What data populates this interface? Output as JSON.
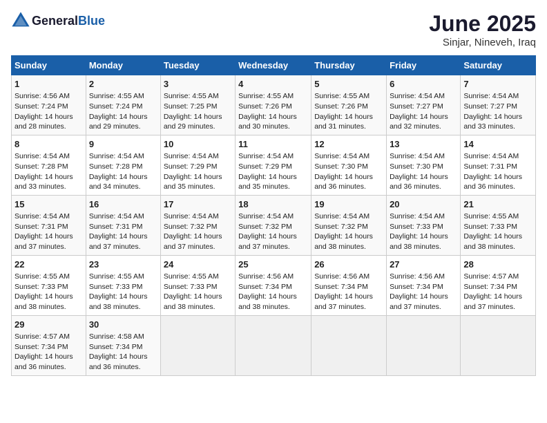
{
  "header": {
    "logo_general": "General",
    "logo_blue": "Blue",
    "title": "June 2025",
    "subtitle": "Sinjar, Nineveh, Iraq"
  },
  "calendar": {
    "weekdays": [
      "Sunday",
      "Monday",
      "Tuesday",
      "Wednesday",
      "Thursday",
      "Friday",
      "Saturday"
    ],
    "rows": [
      [
        {
          "day": "1",
          "lines": [
            "Sunrise: 4:56 AM",
            "Sunset: 7:24 PM",
            "Daylight: 14 hours",
            "and 28 minutes."
          ]
        },
        {
          "day": "2",
          "lines": [
            "Sunrise: 4:55 AM",
            "Sunset: 7:24 PM",
            "Daylight: 14 hours",
            "and 29 minutes."
          ]
        },
        {
          "day": "3",
          "lines": [
            "Sunrise: 4:55 AM",
            "Sunset: 7:25 PM",
            "Daylight: 14 hours",
            "and 29 minutes."
          ]
        },
        {
          "day": "4",
          "lines": [
            "Sunrise: 4:55 AM",
            "Sunset: 7:26 PM",
            "Daylight: 14 hours",
            "and 30 minutes."
          ]
        },
        {
          "day": "5",
          "lines": [
            "Sunrise: 4:55 AM",
            "Sunset: 7:26 PM",
            "Daylight: 14 hours",
            "and 31 minutes."
          ]
        },
        {
          "day": "6",
          "lines": [
            "Sunrise: 4:54 AM",
            "Sunset: 7:27 PM",
            "Daylight: 14 hours",
            "and 32 minutes."
          ]
        },
        {
          "day": "7",
          "lines": [
            "Sunrise: 4:54 AM",
            "Sunset: 7:27 PM",
            "Daylight: 14 hours",
            "and 33 minutes."
          ]
        }
      ],
      [
        {
          "day": "8",
          "lines": [
            "Sunrise: 4:54 AM",
            "Sunset: 7:28 PM",
            "Daylight: 14 hours",
            "and 33 minutes."
          ]
        },
        {
          "day": "9",
          "lines": [
            "Sunrise: 4:54 AM",
            "Sunset: 7:28 PM",
            "Daylight: 14 hours",
            "and 34 minutes."
          ]
        },
        {
          "day": "10",
          "lines": [
            "Sunrise: 4:54 AM",
            "Sunset: 7:29 PM",
            "Daylight: 14 hours",
            "and 35 minutes."
          ]
        },
        {
          "day": "11",
          "lines": [
            "Sunrise: 4:54 AM",
            "Sunset: 7:29 PM",
            "Daylight: 14 hours",
            "and 35 minutes."
          ]
        },
        {
          "day": "12",
          "lines": [
            "Sunrise: 4:54 AM",
            "Sunset: 7:30 PM",
            "Daylight: 14 hours",
            "and 36 minutes."
          ]
        },
        {
          "day": "13",
          "lines": [
            "Sunrise: 4:54 AM",
            "Sunset: 7:30 PM",
            "Daylight: 14 hours",
            "and 36 minutes."
          ]
        },
        {
          "day": "14",
          "lines": [
            "Sunrise: 4:54 AM",
            "Sunset: 7:31 PM",
            "Daylight: 14 hours",
            "and 36 minutes."
          ]
        }
      ],
      [
        {
          "day": "15",
          "lines": [
            "Sunrise: 4:54 AM",
            "Sunset: 7:31 PM",
            "Daylight: 14 hours",
            "and 37 minutes."
          ]
        },
        {
          "day": "16",
          "lines": [
            "Sunrise: 4:54 AM",
            "Sunset: 7:31 PM",
            "Daylight: 14 hours",
            "and 37 minutes."
          ]
        },
        {
          "day": "17",
          "lines": [
            "Sunrise: 4:54 AM",
            "Sunset: 7:32 PM",
            "Daylight: 14 hours",
            "and 37 minutes."
          ]
        },
        {
          "day": "18",
          "lines": [
            "Sunrise: 4:54 AM",
            "Sunset: 7:32 PM",
            "Daylight: 14 hours",
            "and 37 minutes."
          ]
        },
        {
          "day": "19",
          "lines": [
            "Sunrise: 4:54 AM",
            "Sunset: 7:32 PM",
            "Daylight: 14 hours",
            "and 38 minutes."
          ]
        },
        {
          "day": "20",
          "lines": [
            "Sunrise: 4:54 AM",
            "Sunset: 7:33 PM",
            "Daylight: 14 hours",
            "and 38 minutes."
          ]
        },
        {
          "day": "21",
          "lines": [
            "Sunrise: 4:55 AM",
            "Sunset: 7:33 PM",
            "Daylight: 14 hours",
            "and 38 minutes."
          ]
        }
      ],
      [
        {
          "day": "22",
          "lines": [
            "Sunrise: 4:55 AM",
            "Sunset: 7:33 PM",
            "Daylight: 14 hours",
            "and 38 minutes."
          ]
        },
        {
          "day": "23",
          "lines": [
            "Sunrise: 4:55 AM",
            "Sunset: 7:33 PM",
            "Daylight: 14 hours",
            "and 38 minutes."
          ]
        },
        {
          "day": "24",
          "lines": [
            "Sunrise: 4:55 AM",
            "Sunset: 7:33 PM",
            "Daylight: 14 hours",
            "and 38 minutes."
          ]
        },
        {
          "day": "25",
          "lines": [
            "Sunrise: 4:56 AM",
            "Sunset: 7:34 PM",
            "Daylight: 14 hours",
            "and 38 minutes."
          ]
        },
        {
          "day": "26",
          "lines": [
            "Sunrise: 4:56 AM",
            "Sunset: 7:34 PM",
            "Daylight: 14 hours",
            "and 37 minutes."
          ]
        },
        {
          "day": "27",
          "lines": [
            "Sunrise: 4:56 AM",
            "Sunset: 7:34 PM",
            "Daylight: 14 hours",
            "and 37 minutes."
          ]
        },
        {
          "day": "28",
          "lines": [
            "Sunrise: 4:57 AM",
            "Sunset: 7:34 PM",
            "Daylight: 14 hours",
            "and 37 minutes."
          ]
        }
      ],
      [
        {
          "day": "29",
          "lines": [
            "Sunrise: 4:57 AM",
            "Sunset: 7:34 PM",
            "Daylight: 14 hours",
            "and 36 minutes."
          ]
        },
        {
          "day": "30",
          "lines": [
            "Sunrise: 4:58 AM",
            "Sunset: 7:34 PM",
            "Daylight: 14 hours",
            "and 36 minutes."
          ]
        },
        {
          "day": "",
          "lines": []
        },
        {
          "day": "",
          "lines": []
        },
        {
          "day": "",
          "lines": []
        },
        {
          "day": "",
          "lines": []
        },
        {
          "day": "",
          "lines": []
        }
      ]
    ]
  }
}
